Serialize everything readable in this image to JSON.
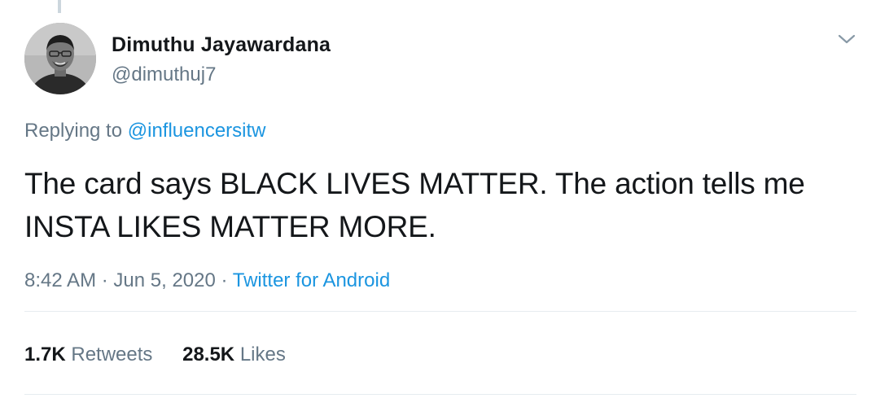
{
  "tweet": {
    "author": {
      "name": "Dimuthu Jayawardana",
      "handle": "@dimuthuj7"
    },
    "reply": {
      "prefix": "Replying to ",
      "mention": "@influencersitw"
    },
    "text": "The card says BLACK LIVES MATTER. The action tells me INSTA LIKES MATTER MORE.",
    "meta": {
      "time": "8:42 AM",
      "date": "Jun 5, 2020",
      "separator": "·",
      "source": "Twitter for Android"
    },
    "stats": {
      "retweets_count": "1.7K",
      "retweets_label": "Retweets",
      "likes_count": "28.5K",
      "likes_label": "Likes"
    }
  },
  "icons": {
    "menu": "chevron-down-icon",
    "avatar": "user-avatar"
  },
  "colors": {
    "link": "#1b95e0",
    "secondary_text": "#657786",
    "primary_text": "#14171a",
    "divider": "#e6ecf0"
  }
}
